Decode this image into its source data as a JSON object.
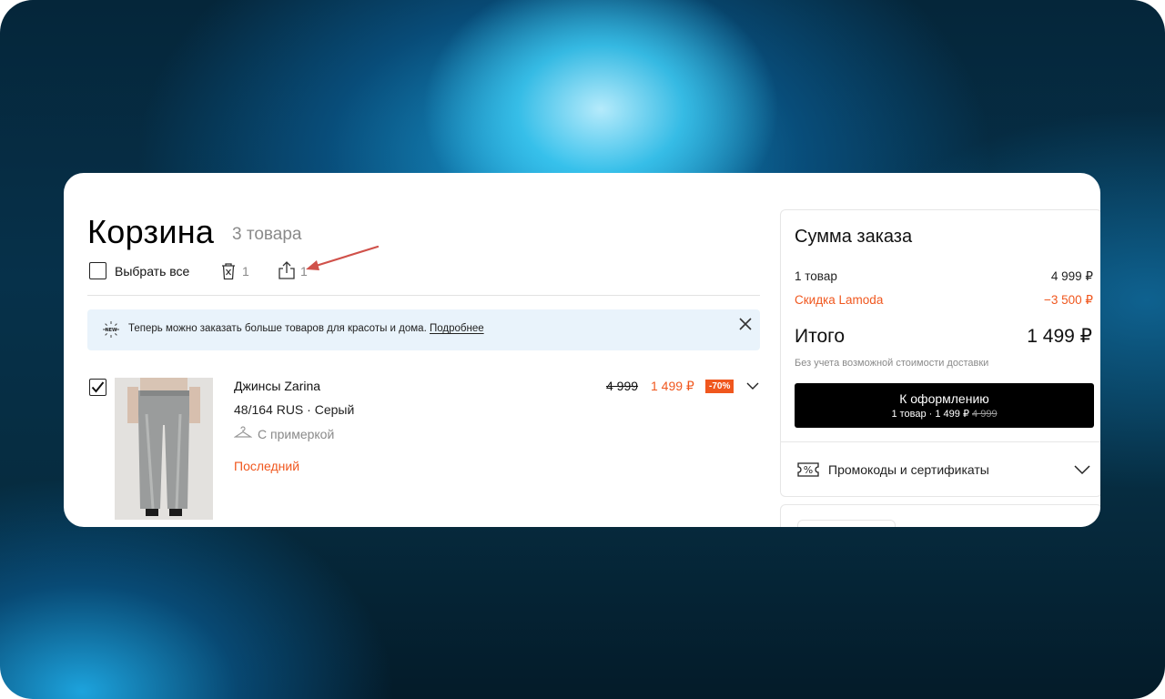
{
  "cart": {
    "title": "Корзина",
    "count": "3 товара",
    "select_all": "Выбрать все",
    "delete_count": "1",
    "share_count": "1"
  },
  "banner": {
    "text": "Теперь можно заказать больше товаров для красоты и дома. ",
    "link": "Подробнее"
  },
  "item": {
    "name": "Джинсы Zarina",
    "size_color": "48/164 RUS · Серый",
    "fitting": "С примеркой",
    "badge": "Последний",
    "old_price": "4 999",
    "new_price": "1 499 ₽",
    "discount": "-70%"
  },
  "summary": {
    "title": "Сумма заказа",
    "items_label": "1 товар",
    "items_value": "4 999 ₽",
    "discount_label": "Скидка Lamoda",
    "discount_value": "−3 500 ₽",
    "total_label": "Итого",
    "total_value": "1 499 ₽",
    "delivery_note": "Без учета возможной стоимости доставки",
    "checkout_label": "К оформлению",
    "checkout_sub": "1 товар · 1 499 ₽",
    "checkout_old": "4 999",
    "promo_label": "Промокоды и сертификаты"
  },
  "colors": {
    "accent": "#f0571e",
    "banner_bg": "#e9f3fb",
    "button_bg": "#000000"
  },
  "icons": [
    "trash-icon",
    "share-icon",
    "arrow-annotation",
    "new-icon",
    "close-icon",
    "check-icon",
    "hanger-icon",
    "chevron-down-icon",
    "percent-tag-icon"
  ]
}
